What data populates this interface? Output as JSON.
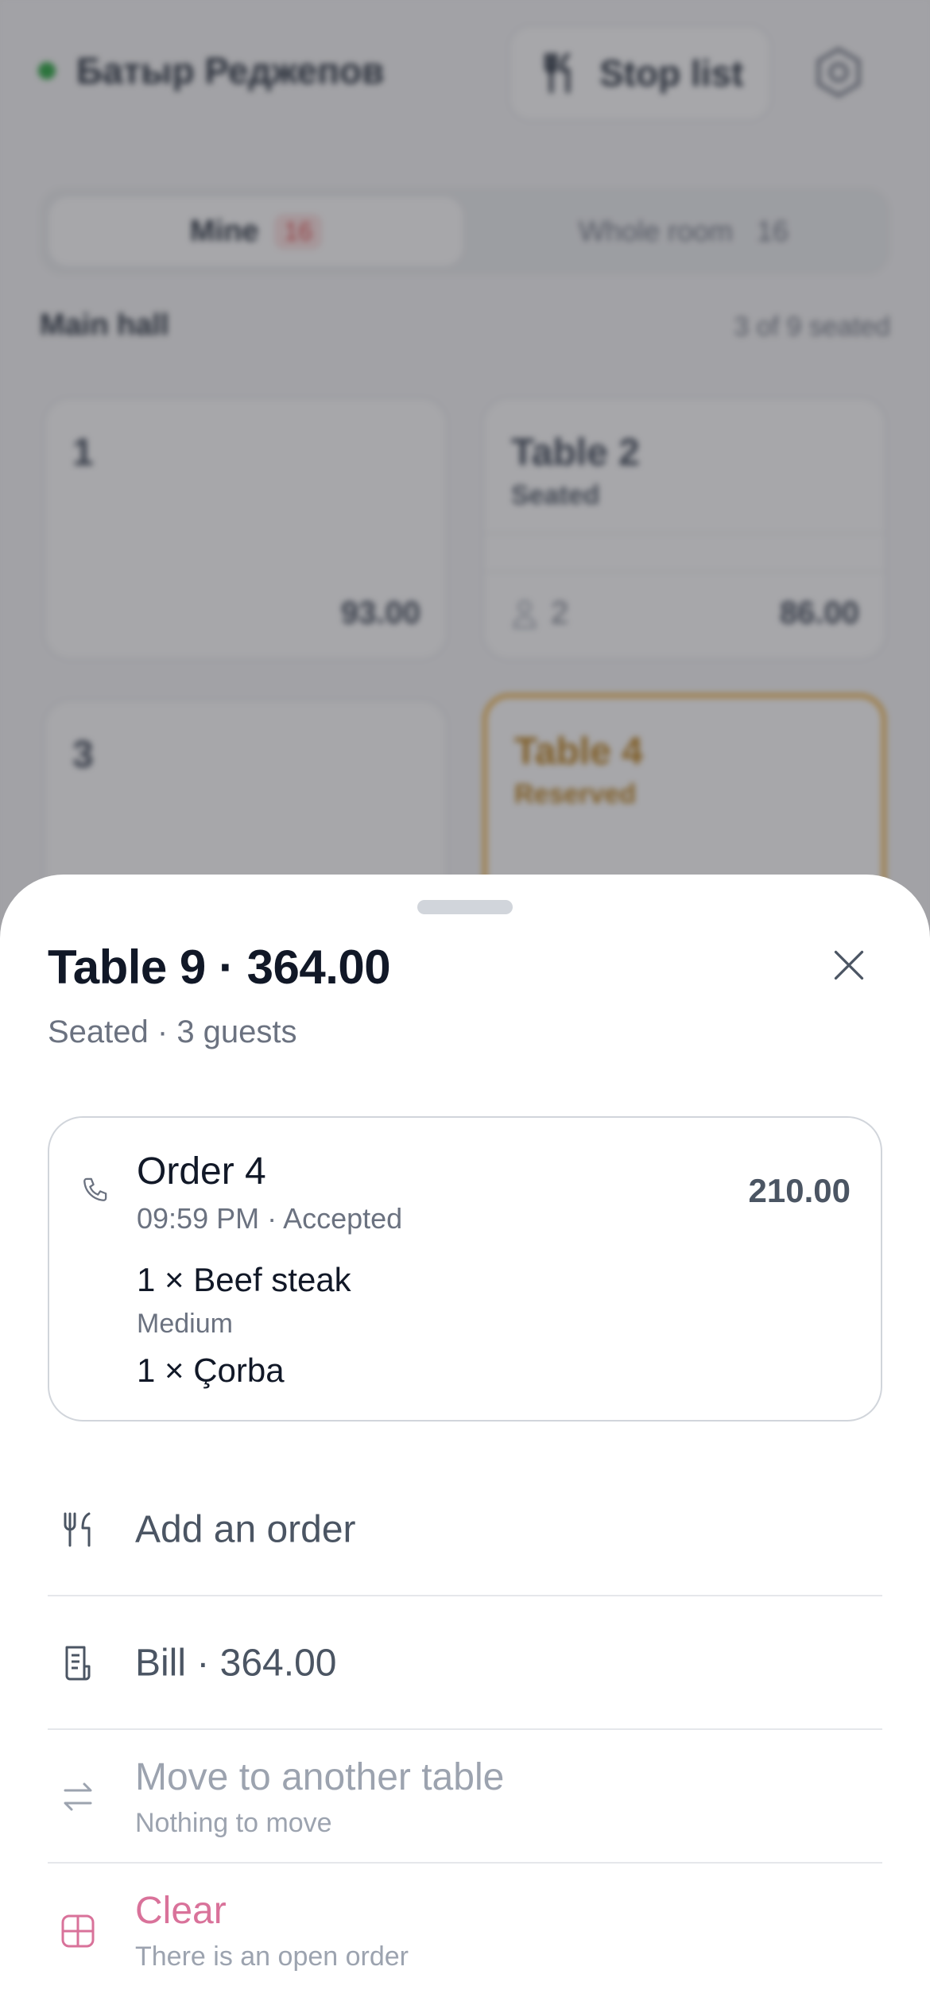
{
  "background": {
    "waiter_name": "Батыр Реджепов",
    "stoplist_label": "Stop list",
    "tabs": [
      {
        "label": "Mine",
        "count": "16"
      },
      {
        "label": "Whole room",
        "count": "16"
      }
    ],
    "hall_name": "Main hall",
    "seated_count": "3 of 9 seated",
    "tables": [
      {
        "name": "1",
        "status": "",
        "guests": "",
        "amount": "93.00"
      },
      {
        "name": "Table 2",
        "status": "Seated",
        "guests": "2",
        "amount": "86.00"
      },
      {
        "name": "3",
        "status": "",
        "guests": "",
        "amount": ""
      },
      {
        "name": "Table 4",
        "status": "Reserved",
        "guests": "",
        "amount": ""
      }
    ]
  },
  "sheet": {
    "title": "Table 9 · 364.00",
    "subtitle": "Seated · 3 guests",
    "order": {
      "title": "Order 4",
      "meta": "09:59 PM · Accepted",
      "total": "210.00",
      "items": [
        {
          "line": "1 × Beef steak",
          "modifier": "Medium"
        },
        {
          "line": "1 × Çorba",
          "modifier": ""
        }
      ]
    },
    "actions": [
      {
        "label": "Add an order",
        "sub": "",
        "icon": "cutlery-icon"
      },
      {
        "label": "Bill · 364.00",
        "sub": "",
        "icon": "receipt-icon"
      },
      {
        "label": "Move to another table",
        "sub": "Nothing to move",
        "icon": "swap-icon"
      },
      {
        "label": "Clear",
        "sub": "There is an open order",
        "icon": "table-grid-icon"
      }
    ]
  },
  "colors": {
    "online": "#22a33a",
    "reserved": "#f0b44a",
    "danger": "#d9729a",
    "badge": "#e04848"
  }
}
